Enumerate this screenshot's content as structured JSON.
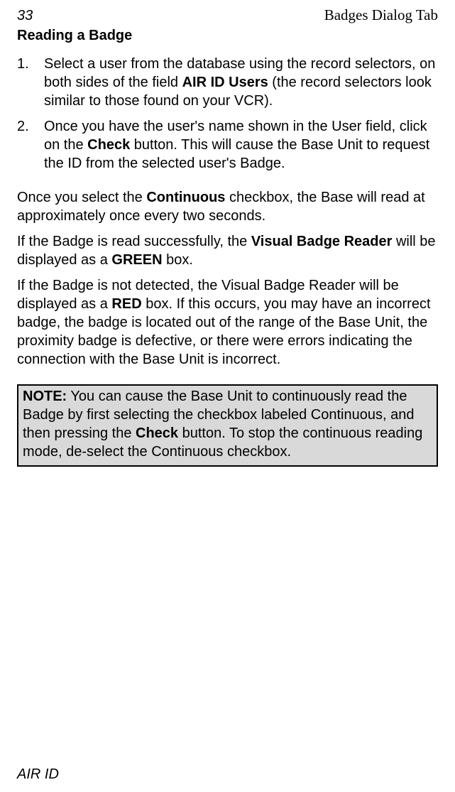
{
  "header": {
    "page_number": "33",
    "tab_title": "Badges Dialog Tab"
  },
  "section_heading": "Reading a Badge",
  "list": {
    "item1": {
      "num": "1.",
      "pre": "Select a user from the database using the record selectors, on both sides of the field ",
      "bold": "AIR ID Users",
      "post": " (the record selectors look similar to those found on your VCR)."
    },
    "item2": {
      "num": "2.",
      "pre": "Once you have the user's name shown in the User field, click on the ",
      "bold": "Check",
      "post": " button.   This will cause the Base Unit to request the ID from the selected user's Badge."
    }
  },
  "para1": {
    "pre": "Once you select the ",
    "bold": "Continuous",
    "post": " checkbox, the Base will read at approximately once every two seconds."
  },
  "para2": {
    "pre": "If the Badge is read successfully, the ",
    "bold1": "Visual Badge Reader",
    "mid": " will be displayed as a ",
    "bold2": "GREEN",
    "post": " box."
  },
  "para3": {
    "pre": "If the Badge is not detected, the Visual Badge Reader will be displayed as a ",
    "bold": "RED",
    "post": " box.  If this occurs, you may have an incorrect badge, the badge is located out of the range of the Base Unit, the proximity badge is defective, or there were errors indicating the connection with the Base Unit is incorrect."
  },
  "note": {
    "label": "NOTE:",
    "pre": " You can cause the Base Unit to continuously read the Badge by first selecting the checkbox labeled Continuous, and then pressing the ",
    "bold": "Check",
    "post": " button. To stop the continuous reading mode, de-select the Continuous checkbox."
  },
  "footer": "AIR ID"
}
